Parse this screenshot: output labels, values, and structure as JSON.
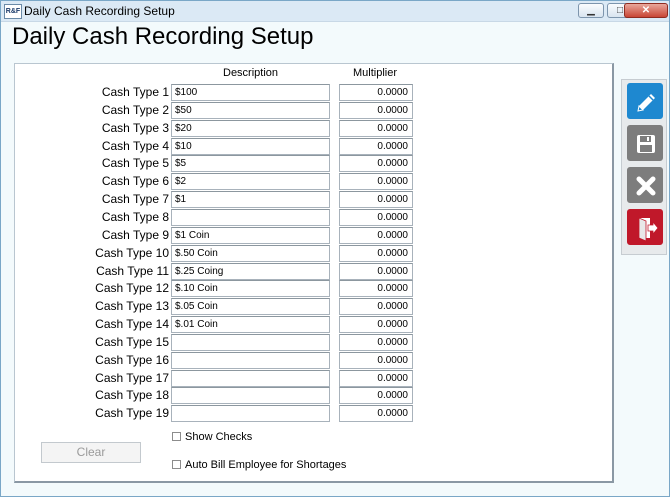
{
  "window": {
    "title": "Daily Cash Recording Setup",
    "app_icon_text": "R&F",
    "minimize_glyph": "▁",
    "maximize_glyph": "□",
    "close_glyph": "✕"
  },
  "heading": "Daily Cash Recording Setup",
  "columns": {
    "description": "Description",
    "multiplier": "Multiplier"
  },
  "rows": [
    {
      "label": "Cash Type 1",
      "description": "$100",
      "multiplier": "0.0000"
    },
    {
      "label": "Cash Type 2",
      "description": "$50",
      "multiplier": "0.0000"
    },
    {
      "label": "Cash Type 3",
      "description": "$20",
      "multiplier": "0.0000"
    },
    {
      "label": "Cash Type 4",
      "description": "$10",
      "multiplier": "0.0000"
    },
    {
      "label": "Cash Type 5",
      "description": "$5",
      "multiplier": "0.0000"
    },
    {
      "label": "Cash Type 6",
      "description": "$2",
      "multiplier": "0.0000"
    },
    {
      "label": "Cash Type 7",
      "description": "$1",
      "multiplier": "0.0000"
    },
    {
      "label": "Cash Type 8",
      "description": "",
      "multiplier": "0.0000"
    },
    {
      "label": "Cash Type 9",
      "description": "$1 Coin",
      "multiplier": "0.0000"
    },
    {
      "label": "Cash Type 10",
      "description": "$.50 Coin",
      "multiplier": "0.0000"
    },
    {
      "label": "Cash Type 11",
      "description": "$.25 Coing",
      "multiplier": "0.0000"
    },
    {
      "label": "Cash Type 12",
      "description": "$.10 Coin",
      "multiplier": "0.0000"
    },
    {
      "label": "Cash Type 13",
      "description": "$.05 Coin",
      "multiplier": "0.0000"
    },
    {
      "label": "Cash Type 14",
      "description": "$.01 Coin",
      "multiplier": "0.0000"
    },
    {
      "label": "Cash Type 15",
      "description": "",
      "multiplier": "0.0000"
    },
    {
      "label": "Cash Type 16",
      "description": "",
      "multiplier": "0.0000"
    },
    {
      "label": "Cash Type 17",
      "description": "",
      "multiplier": "0.0000"
    },
    {
      "label": "Cash Type 18",
      "description": "",
      "multiplier": "0.0000"
    },
    {
      "label": "Cash Type 19",
      "description": "",
      "multiplier": "0.0000"
    }
  ],
  "clear_button": "Clear",
  "checkboxes": {
    "show_checks": {
      "label": "Show Checks",
      "checked": false
    },
    "auto_bill": {
      "label": "Auto Bill Employee for Shortages",
      "checked": false
    }
  },
  "sidebar": [
    {
      "icon": "pencil-icon",
      "color": "#1e88d0"
    },
    {
      "icon": "save-icon",
      "color": "#7d7d7d"
    },
    {
      "icon": "cancel-icon",
      "color": "#7d7d7d"
    },
    {
      "icon": "exit-icon",
      "color": "#c0182a"
    }
  ]
}
